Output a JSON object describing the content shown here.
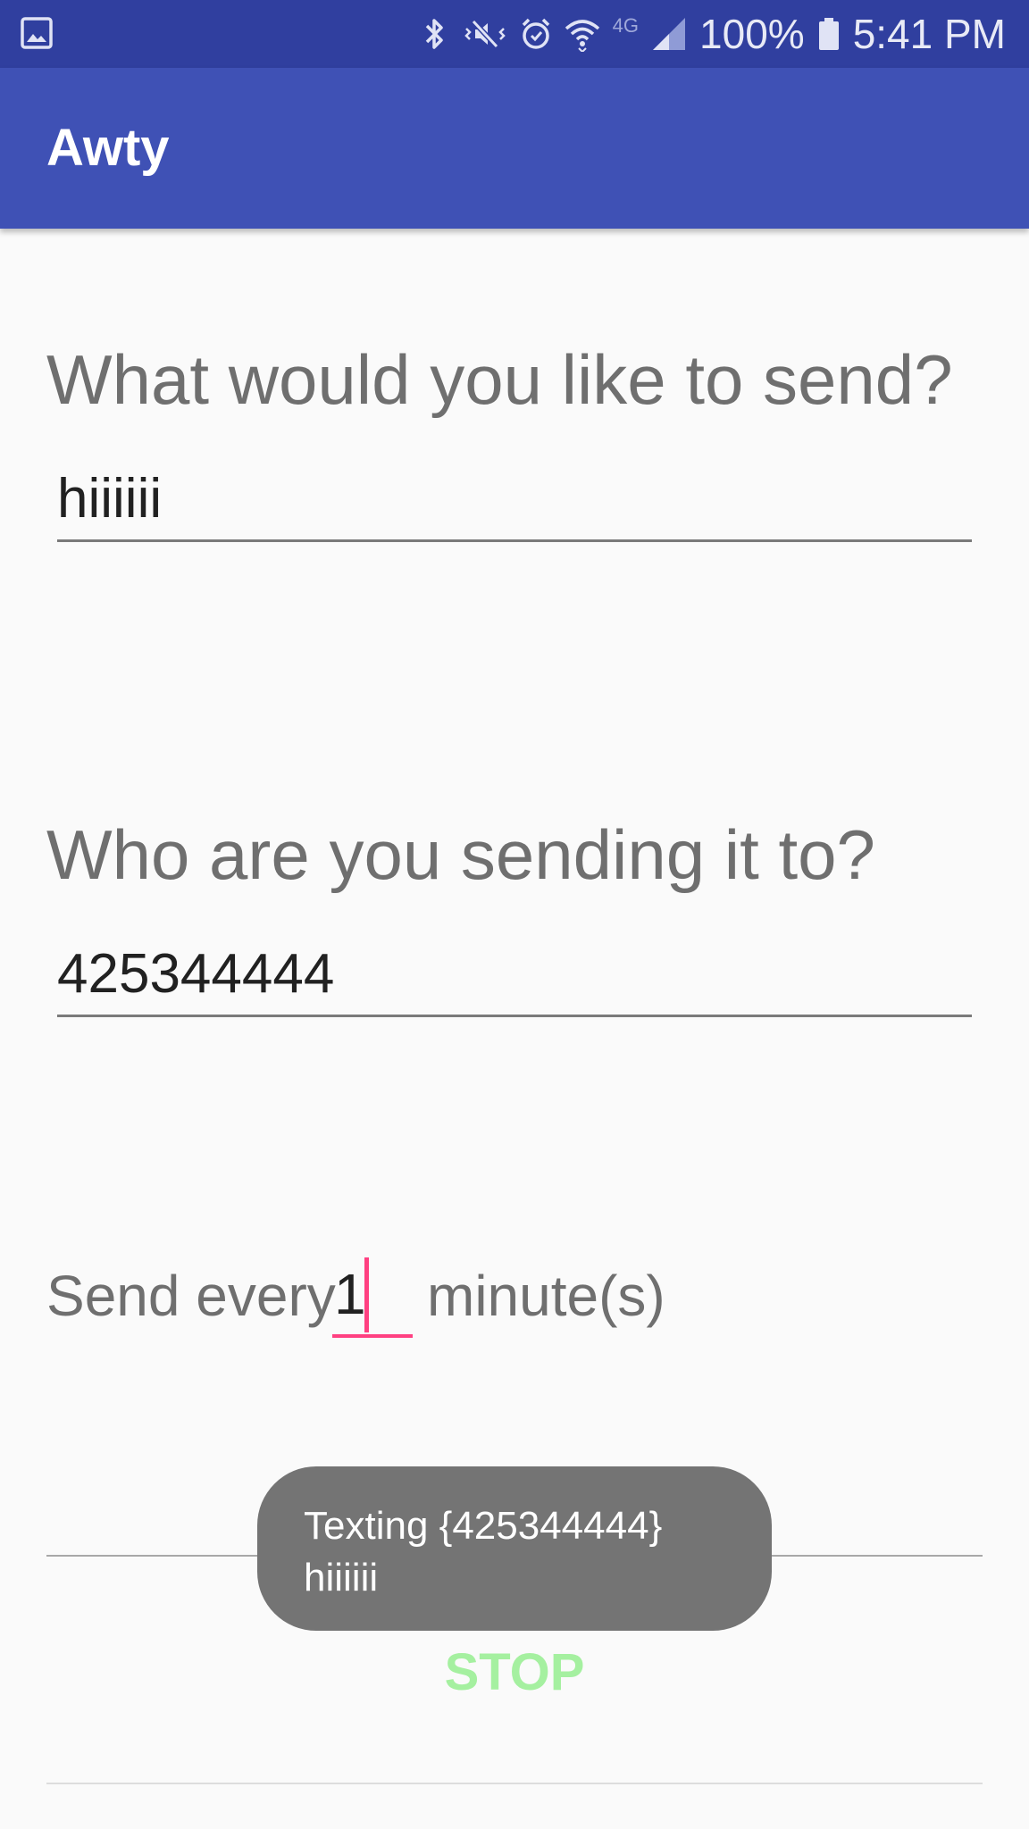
{
  "status_bar": {
    "left_icon": "gallery-notification-icon",
    "icons": [
      "bluetooth-icon",
      "vibrate-mute-icon",
      "alarm-icon",
      "wifi-icon",
      "4g-lte-icon",
      "signal-icon",
      "battery-icon"
    ],
    "network_label": "4G",
    "battery_percent": "100%",
    "time": "5:41 PM"
  },
  "app_bar": {
    "title": "Awty",
    "color": "#3f51b5",
    "status_color": "#303f9f"
  },
  "form": {
    "message_prompt": "What would you like to send?",
    "message_value": "hiiiiii",
    "recipient_prompt": "Who are you sending it to?",
    "recipient_value": "425344444",
    "interval_prefix": "Send every",
    "interval_value": "1",
    "interval_suffix": "minute(s)",
    "accent_color": "#ff4081"
  },
  "stop_button": {
    "label": "STOP",
    "color": "#a5f0a0"
  },
  "toast": {
    "line1": "Texting {425344444}",
    "line2": "hiiiiii"
  }
}
